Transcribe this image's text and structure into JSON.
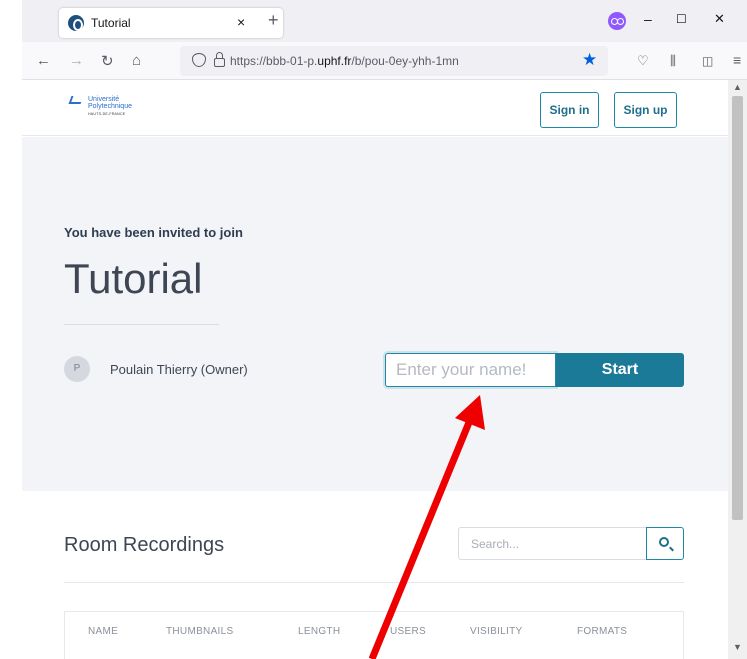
{
  "browser": {
    "tab_title": "Tutorial",
    "tab_close": "×",
    "new_tab": "+",
    "url_prefix": "https://bbb-01-p.",
    "url_domain": "uphf.fr",
    "url_path": "/b/pou-0ey-yhh-1mn",
    "minimize": "–",
    "maximize": "☐",
    "close": "✕"
  },
  "header": {
    "logo_line1": "Université",
    "logo_line2": "Polytechnique",
    "logo_line3": "HAUTS-DE-FRANCE",
    "sign_in": "Sign in",
    "sign_up": "Sign up"
  },
  "hero": {
    "invited_text": "You have been invited to join",
    "room_title": "Tutorial",
    "owner_initial": "P",
    "owner_name": "Poulain Thierry (Owner)",
    "name_placeholder": "Enter your name!",
    "start_label": "Start"
  },
  "recordings": {
    "title": "Room Recordings",
    "search_placeholder": "Search...",
    "columns": [
      "NAME",
      "THUMBNAILS",
      "LENGTH",
      "USERS",
      "VISIBILITY",
      "FORMATS"
    ]
  },
  "colors": {
    "accent": "#1c7a99",
    "annotation_arrow": "#ee0000"
  }
}
